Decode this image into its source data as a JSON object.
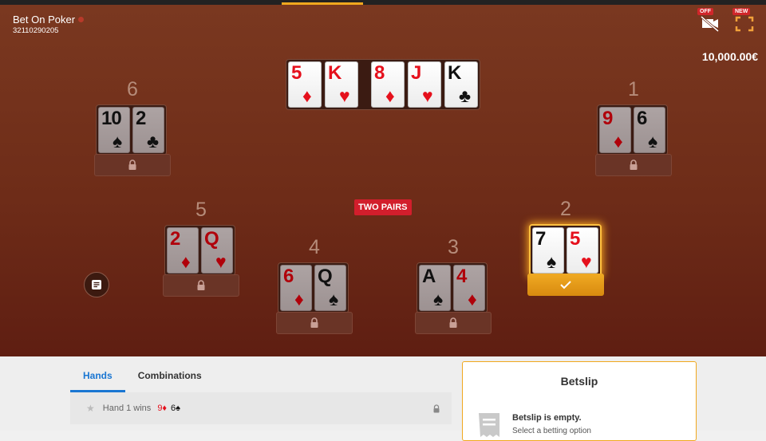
{
  "header": {
    "title": "Bet On Poker",
    "game_id": "32110290205",
    "balance": "10,000.00€",
    "video_badge": "OFF",
    "fullscreen_badge": "NEW"
  },
  "board": {
    "cards": [
      {
        "rank": "5",
        "suit": "♦",
        "color": "red"
      },
      {
        "rank": "K",
        "suit": "♥",
        "color": "red"
      },
      {
        "rank": "8",
        "suit": "♦",
        "color": "red"
      },
      {
        "rank": "J",
        "suit": "♥",
        "color": "red"
      },
      {
        "rank": "K",
        "suit": "♣",
        "color": "black"
      }
    ]
  },
  "combination_label": "TWO PAIRS",
  "hands": [
    {
      "number": "6",
      "cards": [
        {
          "rank": "10",
          "suit": "♠",
          "color": "black"
        },
        {
          "rank": "2",
          "suit": "♣",
          "color": "black"
        }
      ],
      "state": "locked"
    },
    {
      "number": "1",
      "cards": [
        {
          "rank": "9",
          "suit": "♦",
          "color": "red"
        },
        {
          "rank": "6",
          "suit": "♠",
          "color": "black"
        }
      ],
      "state": "locked"
    },
    {
      "number": "5",
      "cards": [
        {
          "rank": "2",
          "suit": "♦",
          "color": "red"
        },
        {
          "rank": "Q",
          "suit": "♥",
          "color": "red"
        }
      ],
      "state": "locked"
    },
    {
      "number": "2",
      "cards": [
        {
          "rank": "7",
          "suit": "♠",
          "color": "black"
        },
        {
          "rank": "5",
          "suit": "♥",
          "color": "red"
        }
      ],
      "state": "selected"
    },
    {
      "number": "4",
      "cards": [
        {
          "rank": "6",
          "suit": "♦",
          "color": "red"
        },
        {
          "rank": "Q",
          "suit": "♠",
          "color": "black"
        }
      ],
      "state": "locked"
    },
    {
      "number": "3",
      "cards": [
        {
          "rank": "A",
          "suit": "♠",
          "color": "black"
        },
        {
          "rank": "4",
          "suit": "♦",
          "color": "red"
        }
      ],
      "state": "locked"
    }
  ],
  "tabs": [
    {
      "label": "Hands",
      "active": true
    },
    {
      "label": "Combinations",
      "active": false
    }
  ],
  "hand_rows": [
    {
      "label": "Hand 1 wins",
      "cards": [
        {
          "text": "9♦",
          "color": "red"
        },
        {
          "text": "6♠",
          "color": "black"
        }
      ]
    }
  ],
  "betslip": {
    "title": "Betslip",
    "empty_text": "Betslip is empty.",
    "hint_text": "Select a betting option"
  },
  "icons": {
    "lock": "lock-icon",
    "check": "check-icon",
    "notes": "notes-icon",
    "star": "star-icon",
    "video": "video-off-icon",
    "fullscreen": "fullscreen-icon",
    "receipt": "receipt-icon"
  },
  "colors": {
    "table": "#6e2c18",
    "accent": "#f0a81e",
    "tab_active": "#1a76d2",
    "combo_badge": "#d21e2c"
  }
}
